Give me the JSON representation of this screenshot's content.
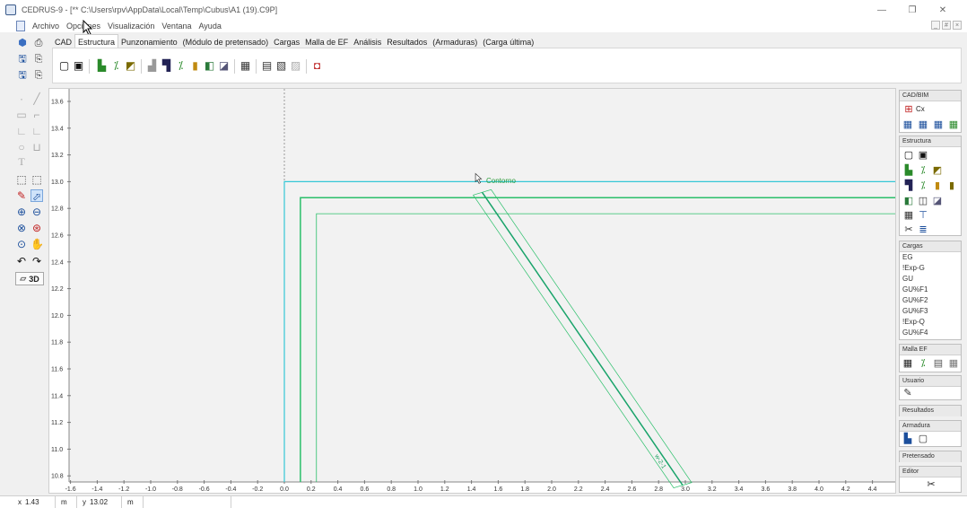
{
  "window": {
    "title": "CEDRUS-9 - [** C:\\Users\\rpv\\AppData\\Local\\Temp\\Cubus\\A1 (19).C9P]",
    "controls": [
      "—",
      "❐",
      "✕"
    ]
  },
  "menubar": {
    "items": [
      "Archivo",
      "Opciones",
      "Visualización",
      "Ventana",
      "Ayuda"
    ],
    "mdi_controls": [
      "_",
      "#",
      "×"
    ]
  },
  "ribbon": {
    "tabs": [
      "CAD",
      "Estructura",
      "Punzonamiento",
      "(Módulo de pretensado)",
      "Cargas",
      "Malla de EF",
      "Análisis",
      "Resultados",
      "(Armaduras)",
      "(Carga última)"
    ],
    "active_tab": "Estructura"
  },
  "left_tools": {
    "button_3d": "3D"
  },
  "canvas": {
    "background": "#f2f2f2",
    "contour_color": "#35c7d6",
    "wall_color": "#2abf6a",
    "beam_axis_color": "#18a36a",
    "x_ticks": [
      "-1.6",
      "-1.4",
      "-1.2",
      "-1.0",
      "-0.8",
      "-0.6",
      "-0.4",
      "-0.2",
      "0.0",
      "0.2",
      "0.4",
      "0.6",
      "0.8",
      "1.0",
      "1.2",
      "1.4",
      "1.6",
      "1.8",
      "2.0",
      "2.2",
      "2.4",
      "2.6",
      "2.8",
      "3.0",
      "3.2",
      "3.4",
      "3.6",
      "3.8",
      "4.0",
      "4.2",
      "4.4"
    ],
    "y_ticks": [
      "13.6",
      "13.4",
      "13.2",
      "13.0",
      "12.8",
      "12.6",
      "12.4",
      "12.2",
      "12.0",
      "11.8",
      "11.6",
      "11.4",
      "11.2",
      "11.0",
      "10.8"
    ],
    "contour_label": "Contorno",
    "beam_label": "w-2-1"
  },
  "side_panel": {
    "cad_bim": {
      "title": "CAD/BIM",
      "cx_label": "Cx"
    },
    "estructura": {
      "title": "Estructura"
    },
    "cargas": {
      "title": "Cargas",
      "items": [
        "EG",
        "!Exp-G",
        "GU",
        "GU%F1",
        "GU%F2",
        "GU%F3",
        "!Exp-Q",
        "GU%F4"
      ]
    },
    "malla_ef": {
      "title": "Malla EF"
    },
    "usuario": {
      "title": "Usuario"
    },
    "resultados": {
      "title": "Resultados"
    },
    "armadura": {
      "title": "Armadura"
    },
    "pretensado": {
      "title": "Pretensado"
    },
    "editor": {
      "title": "Editor"
    }
  },
  "statusbar": {
    "x_label": "x",
    "x_value": "1.43",
    "x_unit": "m",
    "y_label": "y",
    "y_value": "13.02",
    "y_unit": "m"
  }
}
